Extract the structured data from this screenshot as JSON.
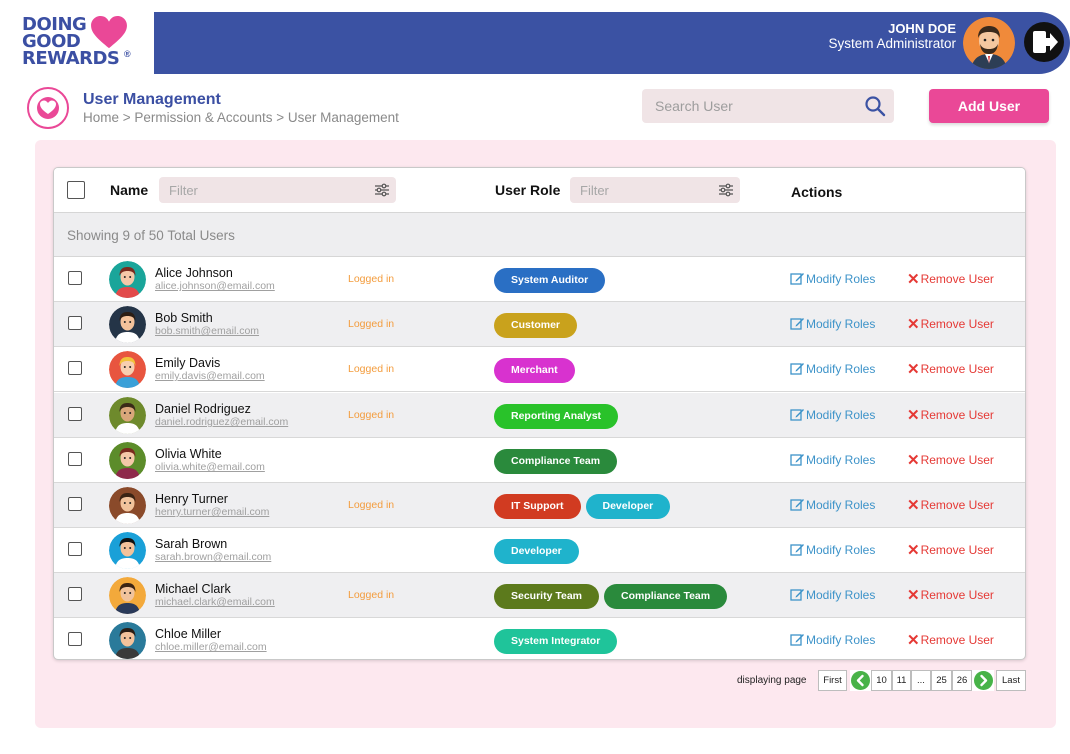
{
  "brand": {
    "logo_lines": [
      "DOING",
      "GOOD",
      "REWARDS"
    ],
    "logo_reg": "®",
    "badge_text": "DOING GOOD REWARDS",
    "colors": {
      "primary": "#3b52a3",
      "accent": "#ea4897",
      "panel": "#fde8ef"
    }
  },
  "header": {
    "user_name": "JOHN DOE",
    "user_role": "System Administrator",
    "avatar_icon": "user-avatar-icon",
    "logout_icon": "logout-icon"
  },
  "page": {
    "title": "User Management",
    "breadcrumb": "Home > Permission & Accounts > User Management",
    "search_placeholder": "Search User",
    "add_button": "Add User"
  },
  "table": {
    "col_name": "Name",
    "col_role": "User Role",
    "col_actions": "Actions",
    "filter_placeholder": "Filter",
    "summary": "Showing  9 of 50 Total Users",
    "modify_label": "Modify Roles",
    "remove_label": "Remove User",
    "rows": [
      {
        "name": "Alice Johnson",
        "email": "alice.johnson@email.com",
        "status": "Logged in",
        "roles": [
          {
            "label": "System Auditor",
            "color": "#2a6fc4"
          }
        ],
        "avatar": {
          "bg": "#1aa59a",
          "hair": "#7a2b1f",
          "skin": "#f5c8a8",
          "shirt": "#e24a4a"
        }
      },
      {
        "name": "Bob Smith",
        "email": "bob.smith@email.com",
        "status": "Logged in",
        "roles": [
          {
            "label": "Customer",
            "color": "#c9a21c"
          }
        ],
        "avatar": {
          "bg": "#243447",
          "hair": "#2b1d14",
          "skin": "#f3c29b",
          "shirt": "#ffffff"
        }
      },
      {
        "name": "Emily Davis",
        "email": "emily.davis@email.com",
        "status": "Logged in",
        "roles": [
          {
            "label": "Merchant",
            "color": "#d832cf"
          }
        ],
        "avatar": {
          "bg": "#e8553f",
          "hair": "#f2c23b",
          "skin": "#f7cfb0",
          "shirt": "#3aa0d8"
        }
      },
      {
        "name": "Daniel Rodriguez",
        "email": "daniel.rodriguez@email.com",
        "status": "Logged in",
        "roles": [
          {
            "label": "Reporting Analyst",
            "color": "#29c22a"
          }
        ],
        "avatar": {
          "bg": "#6e8a2c",
          "hair": "#3a2a18",
          "skin": "#d9a77a",
          "shirt": "#ffffff"
        }
      },
      {
        "name": "Olivia White",
        "email": "olivia.white@email.com",
        "status": "",
        "roles": [
          {
            "label": "Compliance Team",
            "color": "#2a8a3c"
          }
        ],
        "avatar": {
          "bg": "#5c8c2a",
          "hair": "#7a2b1f",
          "skin": "#f5c8a8",
          "shirt": "#8e2a4a"
        }
      },
      {
        "name": "Henry Turner",
        "email": "henry.turner@email.com",
        "status": "Logged in",
        "roles": [
          {
            "label": "IT Support",
            "color": "#d13b21"
          },
          {
            "label": "Developer",
            "color": "#1fb3cc"
          }
        ],
        "avatar": {
          "bg": "#8a4a2a",
          "hair": "#3b2414",
          "skin": "#f1c39c",
          "shirt": "#ffffff"
        }
      },
      {
        "name": "Sarah Brown",
        "email": "sarah.brown@email.com",
        "status": "",
        "roles": [
          {
            "label": "Developer",
            "color": "#1fb3cc"
          }
        ],
        "avatar": {
          "bg": "#1aa0d8",
          "hair": "#111111",
          "skin": "#f3c29b",
          "shirt": "#ffffff"
        }
      },
      {
        "name": "Michael Clark",
        "email": "michael.clark@email.com",
        "status": "Logged in",
        "roles": [
          {
            "label": "Security Team",
            "color": "#5c7a1c"
          },
          {
            "label": "Compliance Team",
            "color": "#2a8a3c"
          }
        ],
        "avatar": {
          "bg": "#f3a93b",
          "hair": "#3b2414",
          "skin": "#f1c39c",
          "shirt": "#2a3a5a"
        }
      },
      {
        "name": "Chloe Miller",
        "email": "chloe.miller@email.com",
        "status": "",
        "roles": [
          {
            "label": "System Integrator",
            "color": "#1fc49a"
          }
        ],
        "avatar": {
          "bg": "#2a7a9a",
          "hair": "#2b1d14",
          "skin": "#f3c29b",
          "shirt": "#3a3a3a"
        }
      }
    ]
  },
  "pagination": {
    "label": "displaying page",
    "first": "First",
    "last": "Last",
    "pages": [
      "10",
      "11",
      "...",
      "25",
      "26"
    ],
    "prev_icon": "chevron-left-icon",
    "next_icon": "chevron-right-icon"
  }
}
